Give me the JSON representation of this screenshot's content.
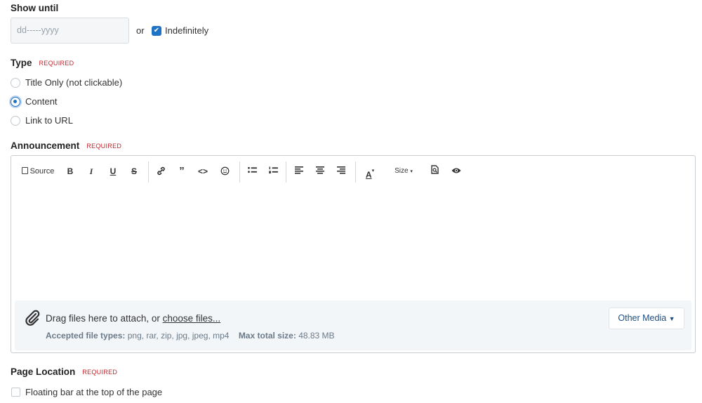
{
  "show_until": {
    "label": "Show until",
    "date_placeholder": "dd-----yyyy",
    "or_text": "or",
    "indefinitely_label": "Indefinitely",
    "indefinitely_checked": true
  },
  "type": {
    "label": "Type",
    "required": "REQUIRED",
    "options": [
      "Title Only (not clickable)",
      "Content",
      "Link to URL"
    ],
    "selected": "Content"
  },
  "announcement": {
    "label": "Announcement",
    "required": "REQUIRED",
    "toolbar": {
      "source_label": "Source",
      "size_label": "Size"
    },
    "dropzone": {
      "text": "Drag files here to attach, or ",
      "link": "choose files...",
      "accepted_label": "Accepted file types:",
      "accepted_value": "png, rar, zip, jpg, jpeg, mp4",
      "max_label": "Max total size:",
      "max_value": "48.83 MB",
      "other_media_label": "Other Media"
    }
  },
  "page_location": {
    "label": "Page Location",
    "required": "REQUIRED",
    "option_label": "Floating bar at the top of the page",
    "option_checked": false
  },
  "colors": {
    "accent": "#1f73c4",
    "required": "#c0262d"
  }
}
